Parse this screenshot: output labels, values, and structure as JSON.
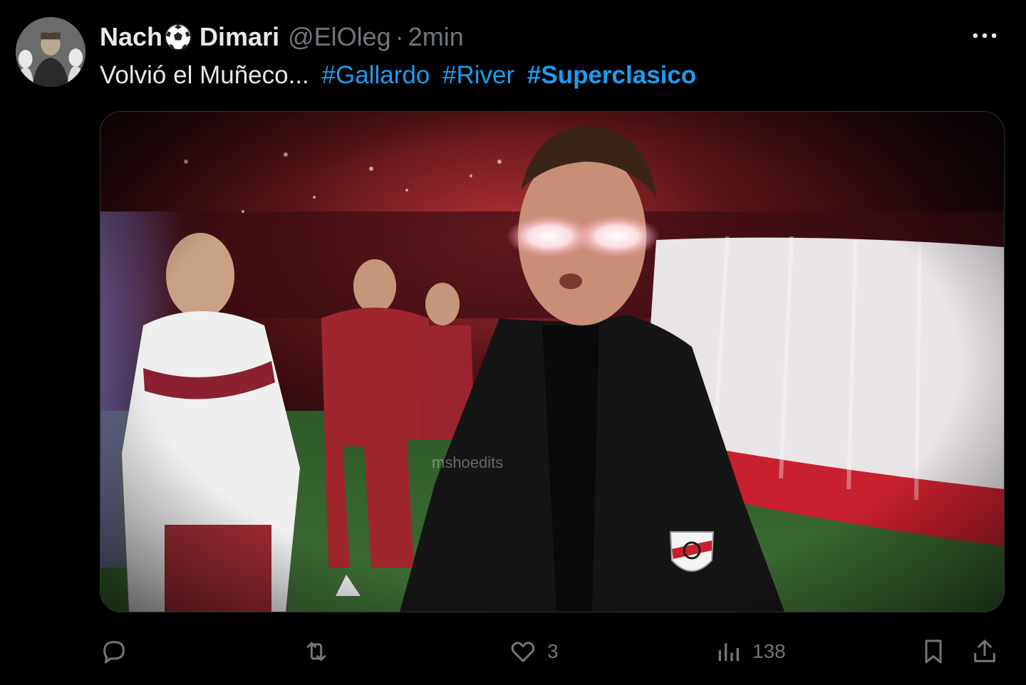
{
  "tweet": {
    "author": {
      "name_part1": "Nach",
      "name_part2": "Dimari",
      "name_emoji_icon": "soccer-ball-icon",
      "handle": "@ElOleg",
      "separator": "·",
      "time": "2min"
    },
    "text": {
      "body": "Volvió el Muñeco...",
      "hashtags": [
        "#Gallardo",
        "#River",
        "#Superclasico"
      ]
    },
    "media": {
      "watermark": "mshoedits"
    },
    "actions": {
      "reply_count": "",
      "retweet_count": "",
      "like_count": "3",
      "views_count": "138"
    },
    "colors": {
      "background": "#000000",
      "text": "#e7e9ea",
      "muted": "#71767b",
      "link": "#1d9bf0"
    }
  }
}
